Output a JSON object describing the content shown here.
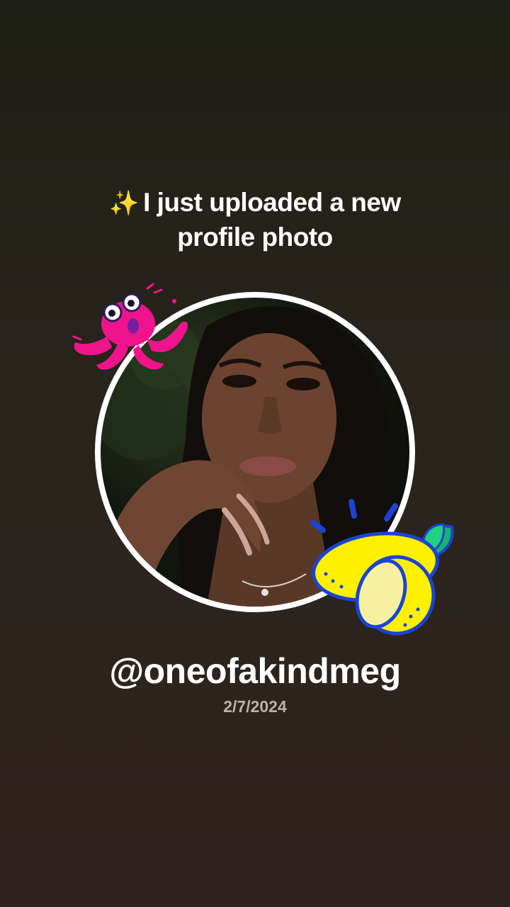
{
  "headline": {
    "icon": "sparkles-icon",
    "sparkle": "✨",
    "line1": "I just uploaded a new",
    "line2": "profile photo"
  },
  "profile": {
    "photo_alt": "Profile photo",
    "username": "@oneofakindmeg",
    "date": "2/7/2024"
  },
  "stickers": {
    "monster": "pink-monster-sticker",
    "lemon": "lemon-sticker"
  },
  "colors": {
    "text": "#ffffff",
    "date": "#b9b2ad",
    "ring": "#ffffff",
    "monster": "#f0148c",
    "lemon": "#fff000",
    "lemon_outline": "#1a44d6",
    "leaf": "#19b36b"
  }
}
